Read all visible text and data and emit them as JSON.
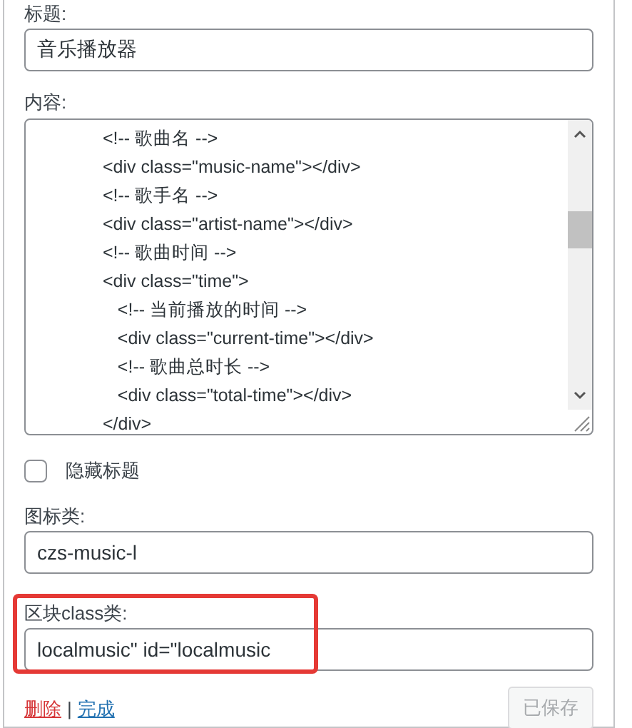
{
  "title_field": {
    "label": "标题:",
    "value": "音乐播放器"
  },
  "content_field": {
    "label": "内容:",
    "lines": [
      "<!-- 歌曲名 -->",
      "<div class=\"music-name\"></div>",
      "<!-- 歌手名 -->",
      "<div class=\"artist-name\"></div>",
      "<!-- 歌曲时间 -->",
      "<div class=\"time\">",
      "   <!-- 当前播放的时间 -->",
      "   <div class=\"current-time\"></div>",
      "   <!-- 歌曲总时长 -->",
      "   <div class=\"total-time\"></div>",
      "</div>"
    ]
  },
  "hide_title": {
    "label": "隐藏标题",
    "checked": false
  },
  "icon_class_field": {
    "label": "图标类:",
    "value": "czs-music-l"
  },
  "block_class_field": {
    "label": "区块class类:",
    "value": "localmusic\" id=\"localmusic",
    "highlighted": true
  },
  "links": [
    {
      "label": "删除",
      "kind": "delete"
    },
    {
      "label": "完成",
      "kind": "done"
    }
  ],
  "link_separator": "|",
  "save_button": {
    "label": "已保存",
    "disabled": true
  }
}
